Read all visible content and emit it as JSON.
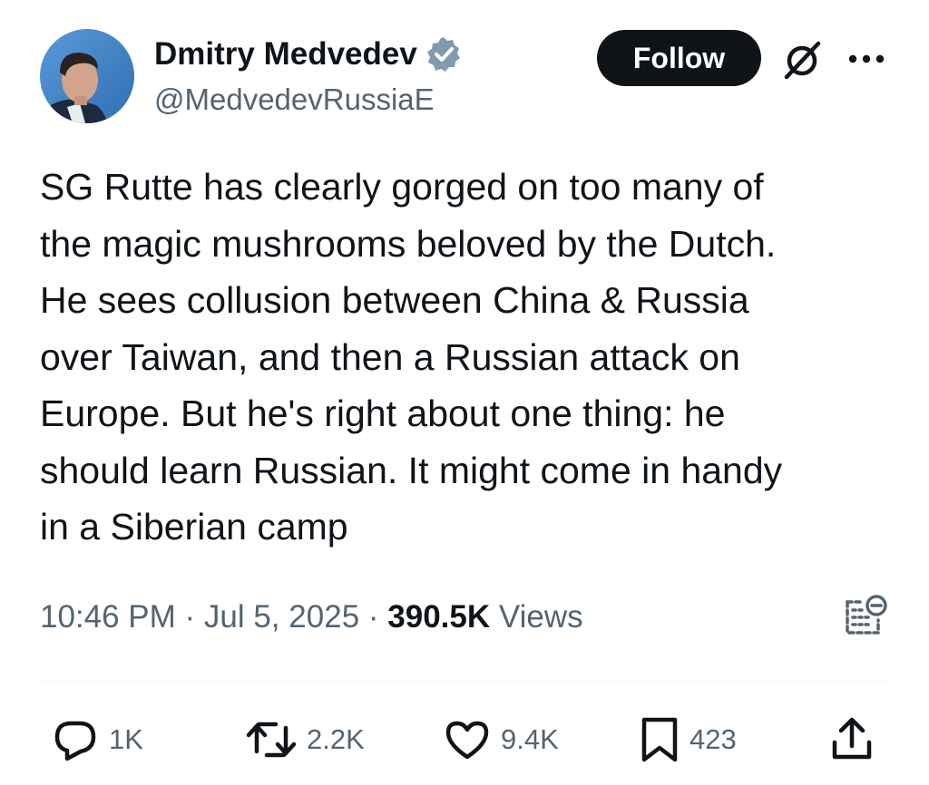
{
  "author": {
    "name": "Dmitry Medvedev",
    "handle": "@MedvedevRussiaE",
    "verified": true,
    "avatar": "profile-photo"
  },
  "header": {
    "follow_label": "Follow",
    "grok_icon": "grok-icon",
    "more_icon": "more-options-icon"
  },
  "tweet": {
    "lines": [
      "SG Rutte has clearly gorged on too many of",
      "the magic mushrooms beloved by the Dutch.",
      "He sees collusion between China & Russia",
      "over Taiwan, and then a Russian attack on",
      "Europe. But he's right about one thing: he",
      "should learn Russian. It might come in handy",
      "in a Siberian camp"
    ]
  },
  "meta": {
    "time": "10:46 PM",
    "separator": " · ",
    "date": "Jul 5, 2025",
    "views_count": "390.5K",
    "views_label": " Views"
  },
  "actions": {
    "replies": "1K",
    "reposts": "2.2K",
    "likes": "9.4K",
    "bookmarks": "423"
  },
  "colors": {
    "text": "#0f1419",
    "secondary": "#536471",
    "verified": "#829aab",
    "divider": "#eff3f4"
  }
}
